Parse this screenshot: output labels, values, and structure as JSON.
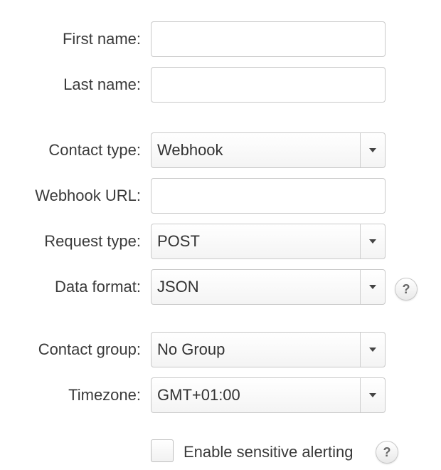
{
  "form": {
    "first_name": {
      "label": "First name:",
      "value": ""
    },
    "last_name": {
      "label": "Last name:",
      "value": ""
    },
    "contact_type": {
      "label": "Contact type:",
      "value": "Webhook"
    },
    "webhook_url": {
      "label": "Webhook URL:",
      "value": ""
    },
    "request_type": {
      "label": "Request type:",
      "value": "POST"
    },
    "data_format": {
      "label": "Data format:",
      "value": "JSON",
      "help_icon": "?"
    },
    "contact_group": {
      "label": "Contact group:",
      "value": "No Group"
    },
    "timezone": {
      "label": "Timezone:",
      "value": "GMT+01:00"
    },
    "sensitive_alerting": {
      "label": "Enable sensitive alerting",
      "checked": false,
      "help_icon": "?"
    }
  }
}
